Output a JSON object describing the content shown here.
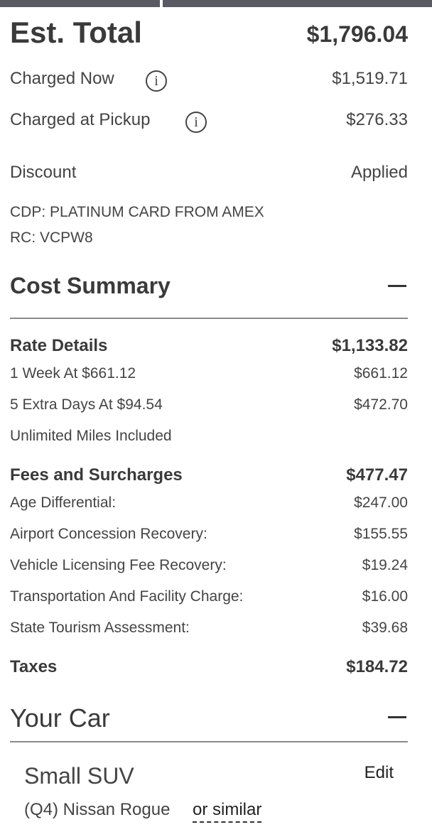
{
  "summary": {
    "est_total_label": "Est. Total",
    "est_total_value": "$1,796.04",
    "charged_now_label": "Charged Now",
    "charged_now_value": "$1,519.71",
    "charged_pickup_label": "Charged at Pickup",
    "charged_pickup_value": "$276.33",
    "info_glyph": "i",
    "discount_label": "Discount",
    "discount_value": "Applied",
    "cdp_line": "CDP: PLATINUM CARD FROM AMEX",
    "rc_line": "RC: VCPW8"
  },
  "cost_summary": {
    "title": "Cost Summary",
    "rate_details": {
      "label": "Rate Details",
      "total": "$1,133.82",
      "items": [
        {
          "label": "1 Week At $661.12",
          "value": "$661.12"
        },
        {
          "label": "5 Extra Days At $94.54",
          "value": "$472.70"
        },
        {
          "label": "Unlimited Miles Included",
          "value": ""
        }
      ]
    },
    "fees": {
      "label": "Fees and Surcharges",
      "total": "$477.47",
      "items": [
        {
          "label": "Age Differential:",
          "value": "$247.00"
        },
        {
          "label": "Airport Concession Recovery:",
          "value": "$155.55"
        },
        {
          "label": "Vehicle Licensing Fee Recovery:",
          "value": "$19.24"
        },
        {
          "label": "Transportation And Facility Charge:",
          "value": "$16.00"
        },
        {
          "label": "State Tourism Assessment:",
          "value": "$39.68"
        }
      ]
    },
    "taxes": {
      "label": "Taxes",
      "value": "$184.72"
    }
  },
  "your_car": {
    "title": "Your Car",
    "class_name": "Small SUV",
    "edit_label": "Edit",
    "model": "(Q4) Nissan Rogue",
    "similar_label": "or similar"
  },
  "icons": {
    "info": "info-icon",
    "collapse": "minus-icon"
  }
}
